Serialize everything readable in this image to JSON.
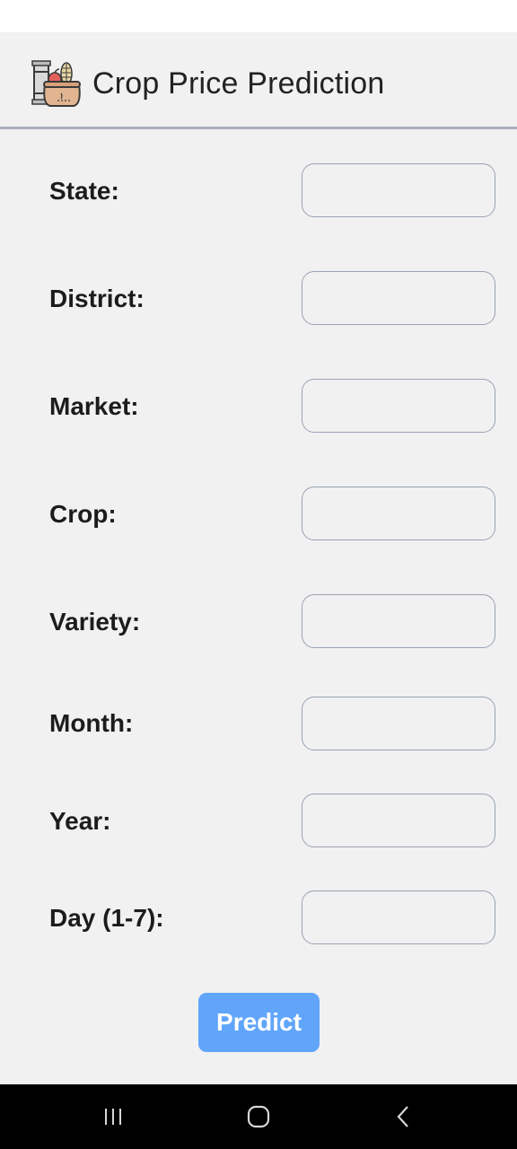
{
  "header": {
    "title": "Crop Price Prediction",
    "logo_icon": "crop-basket-icon"
  },
  "form": {
    "fields": [
      {
        "label": "State:",
        "value": ""
      },
      {
        "label": "District:",
        "value": ""
      },
      {
        "label": "Market:",
        "value": ""
      },
      {
        "label": "Crop:",
        "value": ""
      },
      {
        "label": "Variety:",
        "value": ""
      },
      {
        "label": "Month:",
        "value": ""
      },
      {
        "label": "Year:",
        "value": ""
      },
      {
        "label": "Day (1-7):",
        "value": ""
      }
    ],
    "submit_label": "Predict"
  },
  "nav_bar": {
    "icons": [
      "recent-apps-icon",
      "home-icon",
      "back-icon"
    ]
  },
  "colors": {
    "background": "#f1f1f2",
    "accent": "#60a5fa",
    "input_border": "#9aa3b1",
    "header_border": "#a9aeb8"
  }
}
